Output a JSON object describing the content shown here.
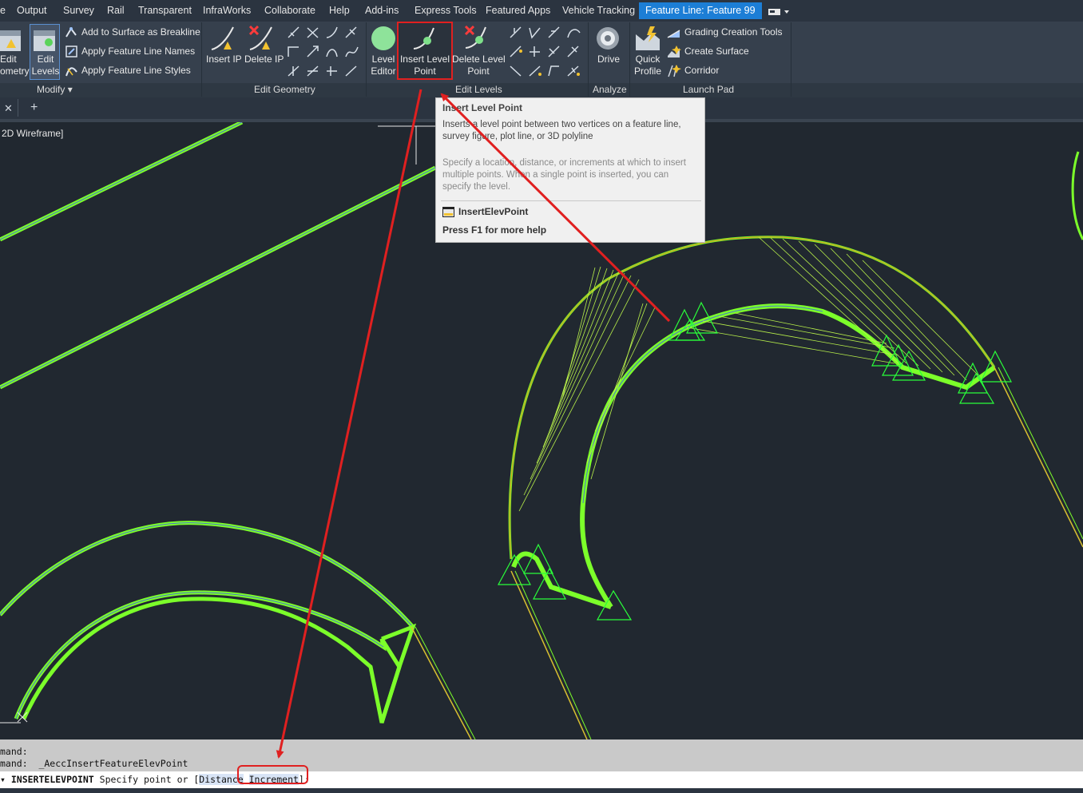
{
  "menubar": {
    "items": [
      "e",
      "Output",
      "Survey",
      "Rail",
      "Transparent",
      "InfraWorks",
      "Collaborate",
      "Help",
      "Add-ins",
      "Express Tools",
      "Featured Apps",
      "Vehicle Tracking"
    ],
    "active_tab": "Feature Line: Feature 99"
  },
  "ribbon": {
    "modify": {
      "edit_geometry": [
        "Edit",
        "ometry"
      ],
      "edit_levels": [
        "Edit",
        "Levels"
      ],
      "add_to_surface": "Add to Surface as Breakline",
      "apply_names": "Apply Feature Line Names",
      "apply_styles": "Apply Feature Line Styles",
      "title": "Modify"
    },
    "edit_geometry": {
      "insert_ip": "Insert IP",
      "delete_ip": "Delete IP",
      "title": "Edit Geometry"
    },
    "edit_levels": {
      "level_editor": [
        "Level",
        "Editor"
      ],
      "insert_level_point": [
        "Insert Level",
        "Point"
      ],
      "delete_level_point": [
        "Delete Level",
        "Point"
      ],
      "title": "Edit Levels"
    },
    "analyze": {
      "drive": "Drive",
      "title": "Analyze"
    },
    "launch_pad": {
      "quick_profile": [
        "Quick",
        "Profile"
      ],
      "grading_tools": "Grading Creation Tools",
      "create_surface": "Create Surface",
      "corridor": "Corridor",
      "title": "Launch Pad"
    }
  },
  "tabs": {
    "close_glyph": "✕",
    "add_glyph": "+"
  },
  "viewport": {
    "label": "2D Wireframe]"
  },
  "tooltip": {
    "title": "Insert Level Point",
    "description": "Inserts a level point between two vertices on a feature line, survey figure, plot line, or 3D polyline",
    "extra": "Specify a location, distance, or increments at which to insert multiple points. When a single point is inserted, you can specify the level.",
    "command": "InsertElevPoint",
    "help": "Press F1 for more help"
  },
  "command": {
    "history": [
      "mand:",
      "mand:  _AeccInsertFeatureElevPoint"
    ],
    "prompt_keyword": "INSERTELEVPOINT",
    "prompt_text": " Specify point or [",
    "option_distance": "Distance",
    "option_increment": "Increment",
    "prompt_end": "]:"
  },
  "colors": {
    "ribbon_bg": "#36404d",
    "menubar_bg": "#2b3440",
    "active_tab": "#1c7ed6",
    "canvas_bg": "#212830",
    "feature_line": "#7cff2a",
    "annotation_red": "#e02020"
  }
}
